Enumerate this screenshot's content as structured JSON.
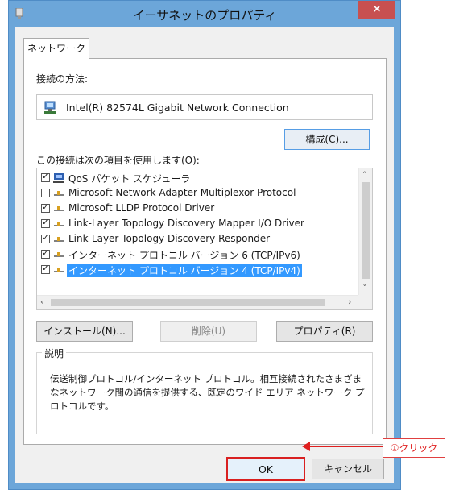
{
  "window": {
    "title": "イーサネットのプロパティ",
    "close_glyph": "×"
  },
  "tab": {
    "label": "ネットワーク"
  },
  "connect_using": {
    "label": "接続の方法:",
    "adapter": "Intel(R) 82574L Gigabit Network Connection"
  },
  "config_button": "構成(C)...",
  "items_label": "この接続は次の項目を使用します(O):",
  "items": [
    {
      "label": "QoS パケット スケジューラ",
      "checked": true,
      "icon": "qos-scheduler-icon"
    },
    {
      "label": "Microsoft Network Adapter Multiplexor Protocol",
      "checked": false,
      "icon": "protocol-icon"
    },
    {
      "label": "Microsoft LLDP Protocol Driver",
      "checked": true,
      "icon": "protocol-icon"
    },
    {
      "label": "Link-Layer Topology Discovery Mapper I/O Driver",
      "checked": true,
      "icon": "protocol-icon"
    },
    {
      "label": "Link-Layer Topology Discovery Responder",
      "checked": true,
      "icon": "protocol-icon"
    },
    {
      "label": "インターネット プロトコル バージョン 6 (TCP/IPv6)",
      "checked": true,
      "icon": "protocol-icon"
    },
    {
      "label": "インターネット プロトコル バージョン 4 (TCP/IPv4)",
      "checked": true,
      "icon": "protocol-icon",
      "selected": true
    }
  ],
  "buttons": {
    "install": "インストール(N)...",
    "remove": "削除(U)",
    "properties": "プロパティ(R)",
    "ok": "OK",
    "cancel": "キャンセル"
  },
  "description": {
    "legend": "説明",
    "text": "伝送制御プロトコル/インターネット プロトコル。相互接続されたさまざまなネットワーク間の通信を提供する、既定のワイド エリア ネットワーク プロトコルです。"
  },
  "annotation": {
    "label": "①クリック",
    "color": "#e02020"
  },
  "colors": {
    "accent": "#3399ff",
    "frame": "#6ca6d9",
    "close": "#c75050",
    "highlight": "#d92020"
  }
}
